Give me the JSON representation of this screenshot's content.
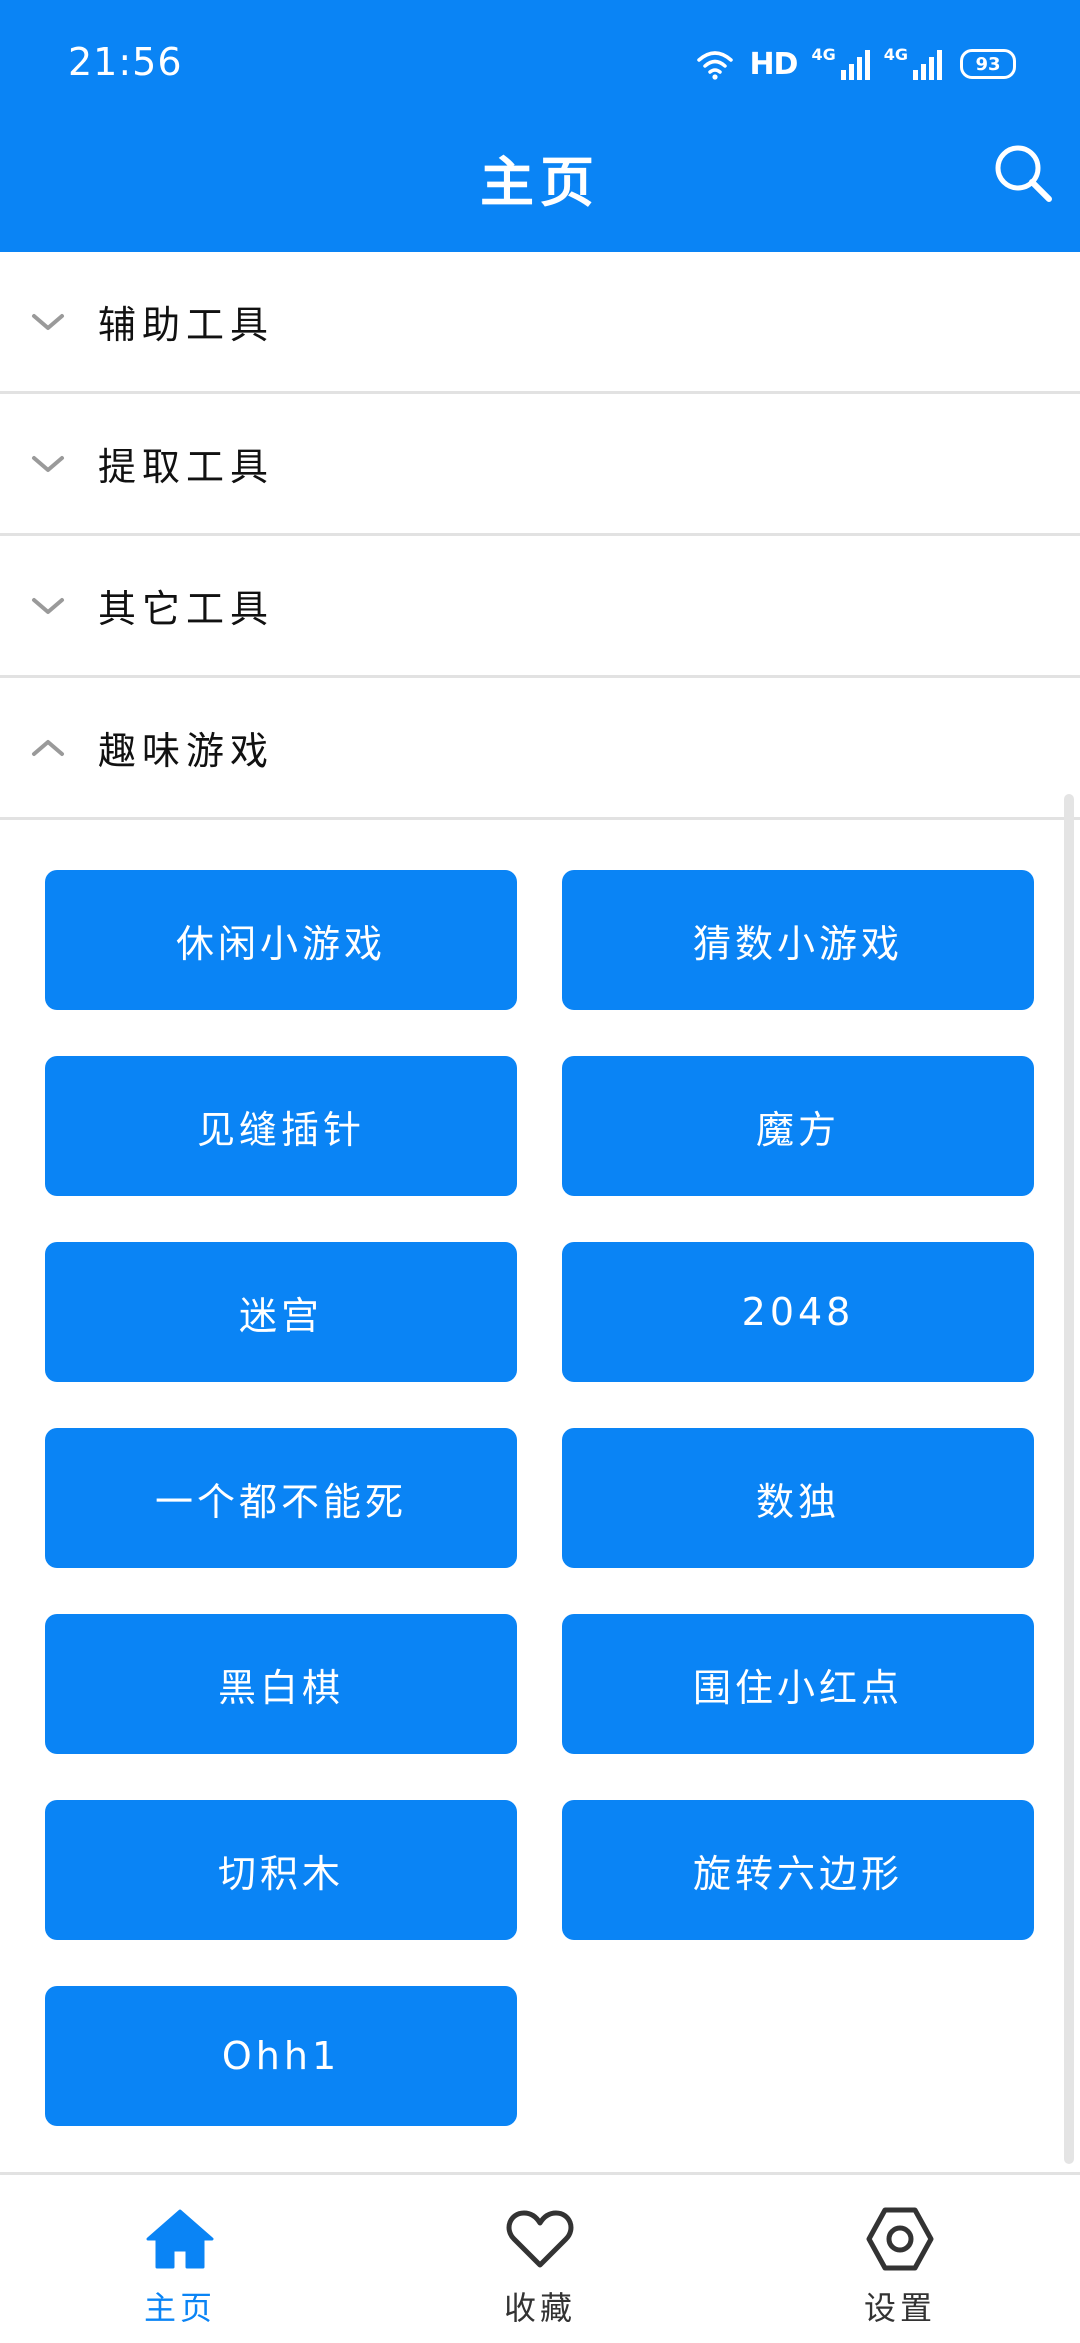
{
  "status_bar": {
    "time": "21:56",
    "hd": "HD",
    "network_1": "4G",
    "network_2": "4G",
    "battery": "93"
  },
  "header": {
    "title": "主页",
    "search_icon": "search-icon"
  },
  "categories": [
    {
      "label": "辅助工具",
      "expanded": false
    },
    {
      "label": "提取工具",
      "expanded": false
    },
    {
      "label": "其它工具",
      "expanded": false
    },
    {
      "label": "趣味游戏",
      "expanded": true
    }
  ],
  "games": [
    "休闲小游戏",
    "猜数小游戏",
    "见缝插针",
    "魔方",
    "迷宫",
    "2048",
    "一个都不能死",
    "数独",
    "黑白棋",
    "围住小红点",
    "切积木",
    "旋转六边形",
    "Ohh1"
  ],
  "bottom_nav": [
    {
      "label": "主页",
      "icon": "home-icon",
      "active": true
    },
    {
      "label": "收藏",
      "icon": "heart-icon",
      "active": false
    },
    {
      "label": "设置",
      "icon": "settings-icon",
      "active": false
    }
  ],
  "colors": {
    "primary": "#0a84f5",
    "divider": "#e2e2e2",
    "text": "#111111"
  }
}
